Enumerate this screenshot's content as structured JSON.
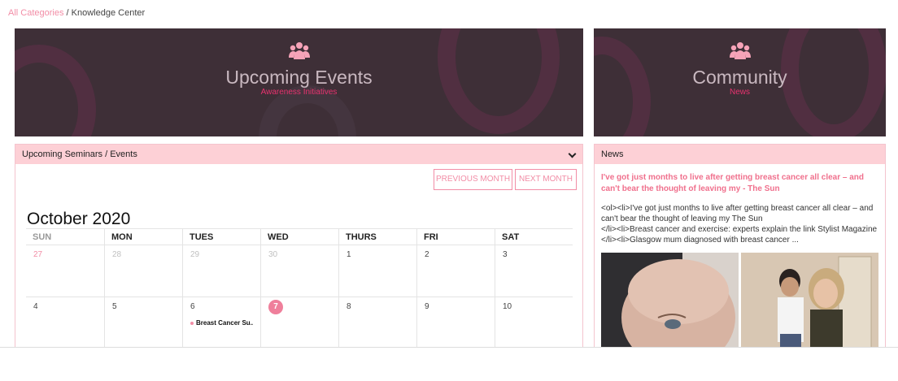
{
  "breadcrumb": {
    "link": "All Categories",
    "separator": " / ",
    "current": "Knowledge Center"
  },
  "banners": {
    "events": {
      "title": "Upcoming Events",
      "subtitle": "Awareness Initiatives",
      "icon": "group-icon"
    },
    "community": {
      "title": "Community",
      "subtitle": "News",
      "icon": "group-icon"
    }
  },
  "seminars": {
    "header": "Upcoming Seminars / Events",
    "prev_label": "PREVIOUS MONTH",
    "next_label": "NEXT MONTH",
    "month_title": "October 2020",
    "weekdays": [
      "SUN",
      "MON",
      "TUES",
      "WED",
      "THURS",
      "FRI",
      "SAT"
    ],
    "week1": [
      "27",
      "28",
      "29",
      "30",
      "1",
      "2",
      "3"
    ],
    "week2": [
      "4",
      "5",
      "6",
      "7",
      "8",
      "9",
      "10"
    ],
    "today": "7",
    "event_label": "Breast Cancer Su..."
  },
  "news": {
    "header": "News",
    "headline": "I've got just months to live after getting breast cancer all clear – and can't bear the thought of leaving my - The Sun",
    "body": "<ol><li>I've got just months to live after getting breast cancer all clear – and can't bear the thought of leaving my  The Sun\n</li><li>Breast cancer and exercise: experts explain the link  Stylist Magazine\n</li><li>Glasgow mum diagnosed with breast cancer ..."
  },
  "colors": {
    "accent": "#f28da6",
    "header_bg": "#fdd0d6",
    "banner_bg": "#3e2f37",
    "subtitle": "#e8326f"
  }
}
